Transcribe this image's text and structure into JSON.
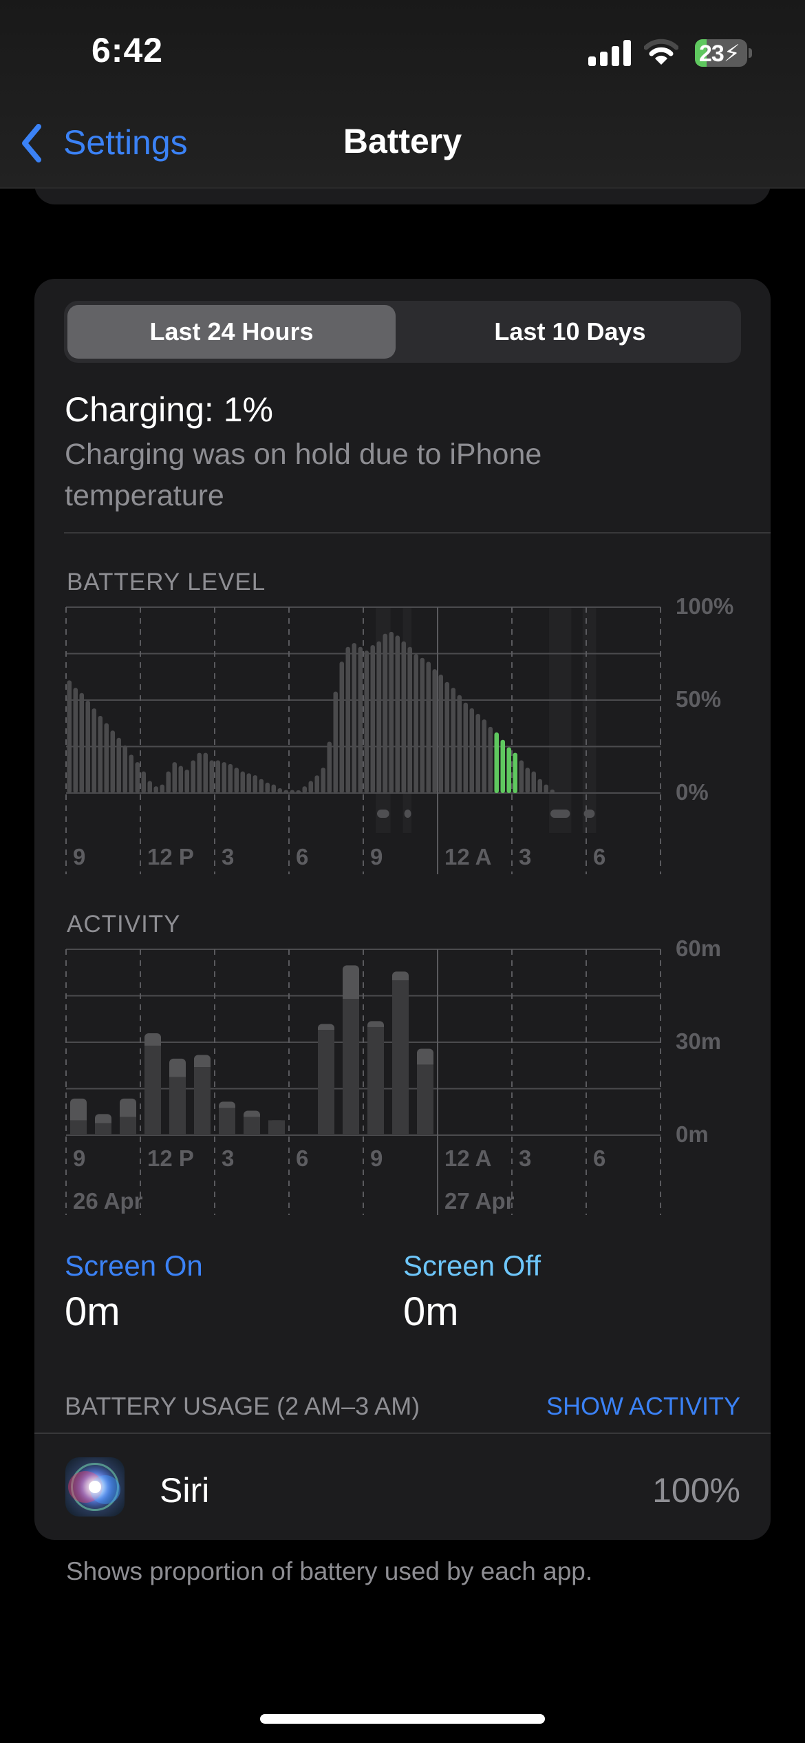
{
  "status_bar": {
    "time": "6:42",
    "battery_percent": "23",
    "battery_level_fraction": 0.23,
    "charging": true,
    "icons": [
      "cellular-signal-icon",
      "wifi-icon",
      "battery-charging-icon"
    ]
  },
  "nav": {
    "back_label": "Settings",
    "title": "Battery"
  },
  "segmented": {
    "options": [
      "Last 24 Hours",
      "Last 10 Days"
    ],
    "selected": "Last 24 Hours"
  },
  "charging": {
    "title": "Charging: 1%",
    "subtitle": "Charging was on hold due to iPhone temperature"
  },
  "colors": {
    "accent_blue": "#3b82f6",
    "screen_off_blue": "#6ec6fa",
    "charging_green": "#5fc85f",
    "bar_gray": "#4a4a4c",
    "card_bg": "#1c1c1e"
  },
  "chart_data": [
    {
      "type": "bar",
      "title": "BATTERY LEVEL",
      "xlabel": "",
      "ylabel": "",
      "interval_minutes": 15,
      "ylim": [
        0,
        100
      ],
      "y_ticks": [
        "100%",
        "50%",
        "0%"
      ],
      "x_ticks": [
        "9",
        "12 P",
        "3",
        "6",
        "9",
        "12 A",
        "3",
        "6"
      ],
      "grid": true,
      "values": [
        60.6,
        56.6,
        53.8,
        49.7,
        45.5,
        41.5,
        37.6,
        33.6,
        29.7,
        25.6,
        20.6,
        16.6,
        11.6,
        6.5,
        3.6,
        4.6,
        11.6,
        16.6,
        14.6,
        12.6,
        17.6,
        21.6,
        21.6,
        17.6,
        17.6,
        16.6,
        15.6,
        13.6,
        11.6,
        10.6,
        9.6,
        7.5,
        5.6,
        4.6,
        2.6,
        1.6,
        1.6,
        0.9,
        3.6,
        6.5,
        9.5,
        13.6,
        27.6,
        54.6,
        70.7,
        78.6,
        80.7,
        78.6,
        76.6,
        79.6,
        81.6,
        85.7,
        86.7,
        84.7,
        81.6,
        78.6,
        74.7,
        72.7,
        70.6,
        66.6,
        63.7,
        59.7,
        56.6,
        52.7,
        48.6,
        45.6,
        42.6,
        39.6,
        35.6,
        32.6,
        28.6,
        24.6,
        21.6,
        17.6,
        13.6,
        11.6,
        7.5,
        4.6,
        1.9
      ],
      "highlighted_range": {
        "from_index": 69,
        "to_index": 72,
        "label": "selected hour 2 AM–3 AM"
      },
      "charging_periods_hours": [
        [
          12.5,
          13.1
        ],
        [
          13.6,
          13.95
        ],
        [
          19.5,
          20.4
        ],
        [
          20.85,
          21.4
        ]
      ]
    },
    {
      "type": "bar",
      "title": "ACTIVITY",
      "xlabel": "",
      "ylabel": "",
      "ylim": [
        0,
        60
      ],
      "y_ticks": [
        "60m",
        "30m",
        "0m"
      ],
      "x_ticks": [
        "9",
        "12 P",
        "3",
        "6",
        "9",
        "12 A",
        "3",
        "6"
      ],
      "date_labels": [
        "26 Apr",
        "27 Apr"
      ],
      "grid": true,
      "categories": [
        "9 AM",
        "10 AM",
        "11 AM",
        "12 PM",
        "1 PM",
        "2 PM",
        "3 PM",
        "4 PM",
        "5 PM",
        "6 PM",
        "7 PM",
        "8 PM",
        "9 PM",
        "10 PM",
        "11 PM",
        "12 AM",
        "1 AM",
        "2 AM",
        "3 AM",
        "4 AM",
        "5 AM",
        "6 AM",
        "7 AM",
        "8 AM"
      ],
      "series": [
        {
          "name": "Screen On",
          "values": [
            4.8,
            3.9,
            5.9,
            28.9,
            18.8,
            22.0,
            8.8,
            5.9,
            4.8,
            0,
            34.0,
            44.0,
            34.9,
            50.0,
            22.8,
            0,
            0,
            0,
            0,
            0,
            0,
            0,
            0,
            0
          ]
        },
        {
          "name": "Screen Off",
          "values": [
            7.0,
            2.9,
            5.9,
            4.0,
            5.9,
            3.9,
            2.0,
            2.0,
            0,
            0,
            1.9,
            10.8,
            1.9,
            2.8,
            5.1,
            0,
            0,
            0,
            0,
            0,
            0,
            0,
            0,
            0
          ]
        }
      ]
    }
  ],
  "legend": {
    "screen_on_label": "Screen On",
    "screen_on_value": "0m",
    "screen_off_label": "Screen Off",
    "screen_off_value": "0m"
  },
  "usage": {
    "header": "BATTERY USAGE (2 AM–3 AM)",
    "action": "SHOW ACTIVITY",
    "apps": [
      {
        "name": "Siri",
        "percent": "100%",
        "icon": "siri-icon"
      }
    ],
    "footer": "Shows proportion of battery used by each app."
  }
}
